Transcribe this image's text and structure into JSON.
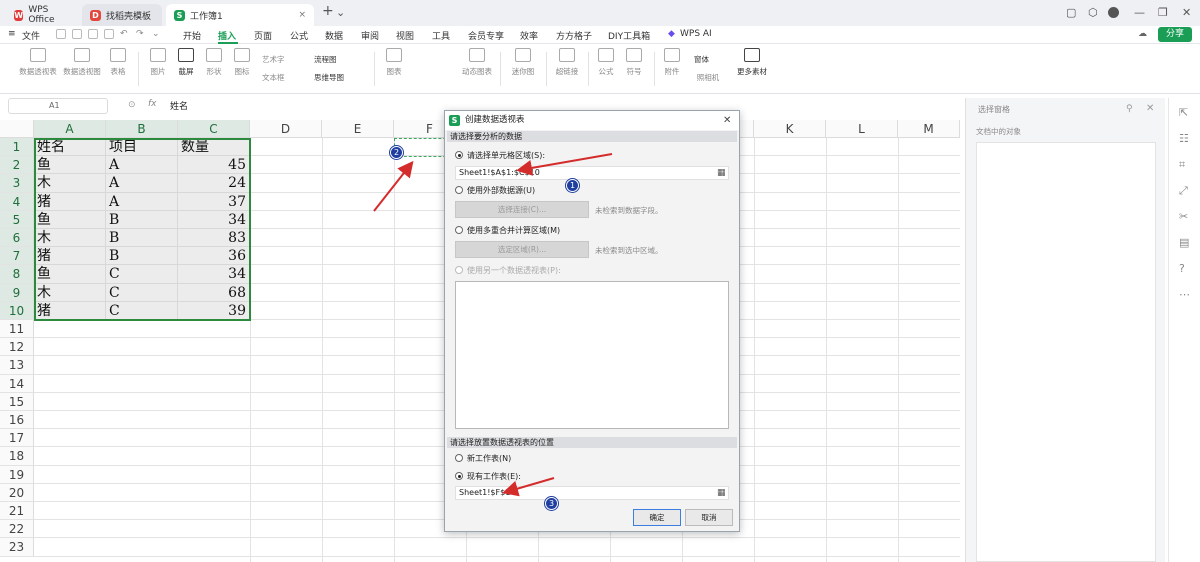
{
  "titlebar": {
    "tabs": [
      {
        "label": "WPS Office"
      },
      {
        "label": "找稻壳模板"
      },
      {
        "label": "工作簿1"
      }
    ],
    "new_tab": "+"
  },
  "menu": {
    "file": "文件",
    "items": [
      "开始",
      "插入",
      "页面",
      "公式",
      "数据",
      "审阅",
      "视图",
      "工具",
      "会员专享",
      "效率",
      "方方格子",
      "DIY工具箱",
      "WPS AI"
    ],
    "active": "插入",
    "share": "分享"
  },
  "ribbon": {
    "items": [
      "数据透视表",
      "数据透视图",
      "表格",
      "图片",
      "截屏",
      "形状",
      "图标",
      "艺术字",
      "文本框",
      "流程图",
      "思维导图",
      "图表",
      "动态图表",
      "迷你图",
      "超链接",
      "公式",
      "符号",
      "附件",
      "照相机",
      "窗体",
      "更多素材"
    ]
  },
  "formula_bar": {
    "cell_ref": "A1",
    "fx": "fx",
    "value": "姓名"
  },
  "grid": {
    "columns": [
      "A",
      "B",
      "C",
      "D",
      "E",
      "F",
      "G",
      "H",
      "I",
      "J",
      "K",
      "L",
      "M"
    ],
    "rows": [
      "1",
      "2",
      "3",
      "4",
      "5",
      "6",
      "7",
      "8",
      "9",
      "10",
      "11",
      "12",
      "13",
      "14",
      "15",
      "16",
      "17",
      "18",
      "19",
      "20",
      "21",
      "22",
      "23"
    ],
    "table": [
      [
        "姓名",
        "项目",
        "数量"
      ],
      [
        "鱼",
        "A",
        "45"
      ],
      [
        "木",
        "A",
        "24"
      ],
      [
        "猪",
        "A",
        "37"
      ],
      [
        "鱼",
        "B",
        "34"
      ],
      [
        "木",
        "B",
        "83"
      ],
      [
        "猪",
        "B",
        "36"
      ],
      [
        "鱼",
        "C",
        "34"
      ],
      [
        "木",
        "C",
        "68"
      ],
      [
        "猪",
        "C",
        "39"
      ]
    ]
  },
  "right_panel": {
    "title": "选择窗格",
    "subtitle": "文档中的对象"
  },
  "dialog": {
    "title": "创建数据透视表",
    "section1": "请选择要分析的数据",
    "opt_range": "请选择单元格区域(S):",
    "range_value": "Sheet1!$A$1:$C$10",
    "opt_external": "使用外部数据源(U)",
    "btn_connect": "选择连接(C)...",
    "note_external": "未检索到数据字段。",
    "opt_multi": "使用多重合并计算区域(M)",
    "btn_region": "选定区域(R)...",
    "note_multi": "未检索到选中区域。",
    "opt_other": "使用另一个数据透视表(P):",
    "section2": "请选择放置数据透视表的位置",
    "opt_new": "新工作表(N)",
    "opt_existing": "现有工作表(E):",
    "location_value": "Sheet1!$F$1",
    "ok": "确定",
    "cancel": "取消"
  },
  "annotations": {
    "badge1": "1",
    "badge2": "2",
    "badge3": "3",
    "arrow_color": "#d42b2b"
  }
}
